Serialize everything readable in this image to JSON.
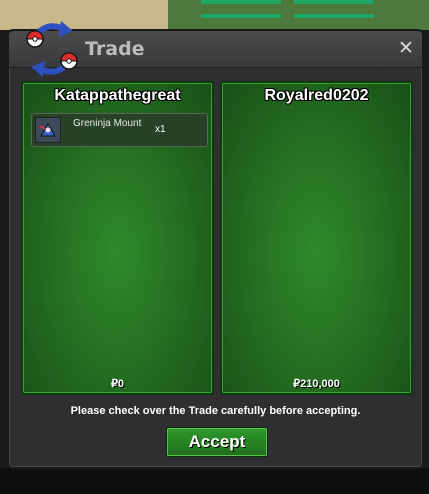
{
  "window": {
    "title": "Trade",
    "close_glyph": "✕"
  },
  "left_panel": {
    "player": "Katappathegreat",
    "items": [
      {
        "name": "Greninja Mount",
        "quantity": "x1",
        "icon": "greninja-mount-icon"
      }
    ],
    "money": "₽0"
  },
  "right_panel": {
    "player": "Royalred0202",
    "items": [],
    "money": "₽210,000"
  },
  "footer": {
    "notice": "Please check over the Trade carefully before accepting.",
    "accept_label": "Accept"
  },
  "colors": {
    "panel_green": "#226b1f",
    "accent_green": "#2f9a2c",
    "window_bg": "#2f2f31"
  }
}
